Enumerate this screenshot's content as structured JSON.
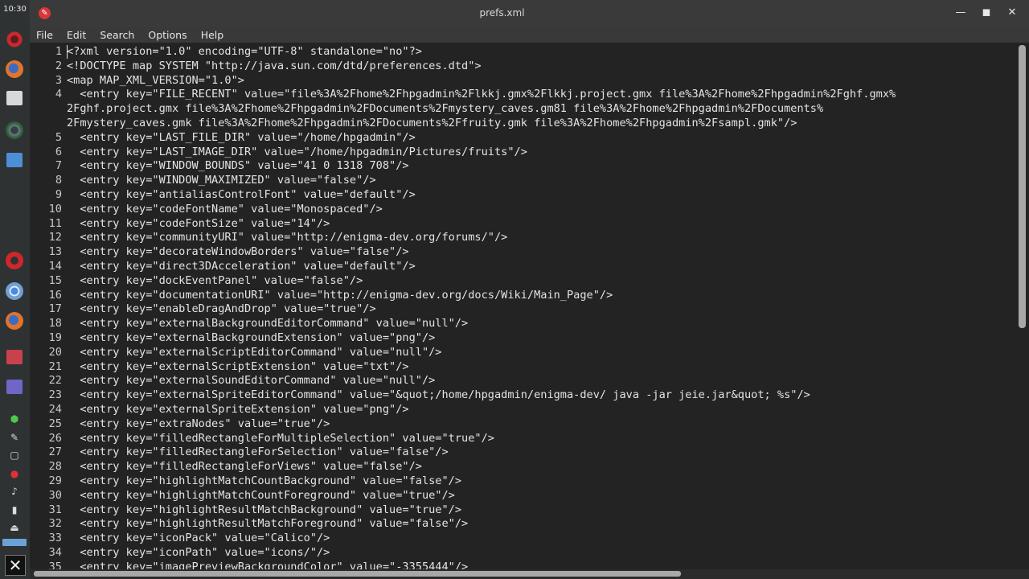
{
  "clock": "10:30",
  "window": {
    "title": "prefs.xml"
  },
  "menu": [
    "File",
    "Edit",
    "Search",
    "Options",
    "Help"
  ],
  "editor": {
    "lines": [
      {
        "n": "1",
        "t": "<?xml version=\"1.0\" encoding=\"UTF-8\" standalone=\"no\"?>"
      },
      {
        "n": "2",
        "t": "<!DOCTYPE map SYSTEM \"http://java.sun.com/dtd/preferences.dtd\">"
      },
      {
        "n": "3",
        "t": "<map MAP_XML_VERSION=\"1.0\">"
      },
      {
        "n": "4",
        "t": "  <entry key=\"FILE_RECENT\" value=\"file%3A%2Fhome%2Fhpgadmin%2Flkkj.gmx%2Flkkj.project.gmx file%3A%2Fhome%2Fhpgadmin%2Fghf.gmx%"
      },
      {
        "n": "",
        "t": "2Fghf.project.gmx file%3A%2Fhome%2Fhpgadmin%2FDocuments%2Fmystery_caves.gm81 file%3A%2Fhome%2Fhpgadmin%2FDocuments%"
      },
      {
        "n": "",
        "t": "2Fmystery_caves.gmk file%3A%2Fhome%2Fhpgadmin%2FDocuments%2Ffruity.gmk file%3A%2Fhome%2Fhpgadmin%2Fsampl.gmk\"/>"
      },
      {
        "n": "5",
        "t": "  <entry key=\"LAST_FILE_DIR\" value=\"/home/hpgadmin\"/>"
      },
      {
        "n": "6",
        "t": "  <entry key=\"LAST_IMAGE_DIR\" value=\"/home/hpgadmin/Pictures/fruits\"/>"
      },
      {
        "n": "7",
        "t": "  <entry key=\"WINDOW_BOUNDS\" value=\"41 0 1318 708\"/>"
      },
      {
        "n": "8",
        "t": "  <entry key=\"WINDOW_MAXIMIZED\" value=\"false\"/>"
      },
      {
        "n": "9",
        "t": "  <entry key=\"antialiasControlFont\" value=\"default\"/>"
      },
      {
        "n": "10",
        "t": "  <entry key=\"codeFontName\" value=\"Monospaced\"/>"
      },
      {
        "n": "11",
        "t": "  <entry key=\"codeFontSize\" value=\"14\"/>"
      },
      {
        "n": "12",
        "t": "  <entry key=\"communityURI\" value=\"http://enigma-dev.org/forums/\"/>"
      },
      {
        "n": "13",
        "t": "  <entry key=\"decorateWindowBorders\" value=\"false\"/>"
      },
      {
        "n": "14",
        "t": "  <entry key=\"direct3DAcceleration\" value=\"default\"/>"
      },
      {
        "n": "15",
        "t": "  <entry key=\"dockEventPanel\" value=\"false\"/>"
      },
      {
        "n": "16",
        "t": "  <entry key=\"documentationURI\" value=\"http://enigma-dev.org/docs/Wiki/Main_Page\"/>"
      },
      {
        "n": "17",
        "t": "  <entry key=\"enableDragAndDrop\" value=\"true\"/>"
      },
      {
        "n": "18",
        "t": "  <entry key=\"externalBackgroundEditorCommand\" value=\"null\"/>"
      },
      {
        "n": "19",
        "t": "  <entry key=\"externalBackgroundExtension\" value=\"png\"/>"
      },
      {
        "n": "20",
        "t": "  <entry key=\"externalScriptEditorCommand\" value=\"null\"/>"
      },
      {
        "n": "21",
        "t": "  <entry key=\"externalScriptExtension\" value=\"txt\"/>"
      },
      {
        "n": "22",
        "t": "  <entry key=\"externalSoundEditorCommand\" value=\"null\"/>"
      },
      {
        "n": "23",
        "t": "  <entry key=\"externalSpriteEditorCommand\" value=\"&quot;/home/hpgadmin/enigma-dev/ java -jar jeie.jar&quot; %s\"/>"
      },
      {
        "n": "24",
        "t": "  <entry key=\"externalSpriteExtension\" value=\"png\"/>"
      },
      {
        "n": "25",
        "t": "  <entry key=\"extraNodes\" value=\"true\"/>"
      },
      {
        "n": "26",
        "t": "  <entry key=\"filledRectangleForMultipleSelection\" value=\"true\"/>"
      },
      {
        "n": "27",
        "t": "  <entry key=\"filledRectangleForSelection\" value=\"false\"/>"
      },
      {
        "n": "28",
        "t": "  <entry key=\"filledRectangleForViews\" value=\"false\"/>"
      },
      {
        "n": "29",
        "t": "  <entry key=\"highlightMatchCountBackground\" value=\"false\"/>"
      },
      {
        "n": "30",
        "t": "  <entry key=\"highlightMatchCountForeground\" value=\"true\"/>"
      },
      {
        "n": "31",
        "t": "  <entry key=\"highlightResultMatchBackground\" value=\"true\"/>"
      },
      {
        "n": "32",
        "t": "  <entry key=\"highlightResultMatchForeground\" value=\"false\"/>"
      },
      {
        "n": "33",
        "t": "  <entry key=\"iconPack\" value=\"Calico\"/>"
      },
      {
        "n": "34",
        "t": "  <entry key=\"iconPath\" value=\"icons/\"/>"
      },
      {
        "n": "35",
        "t": "  <entry key=\"imagePreviewBackgroundColor\" value=\"-3355444\"/>"
      }
    ]
  }
}
